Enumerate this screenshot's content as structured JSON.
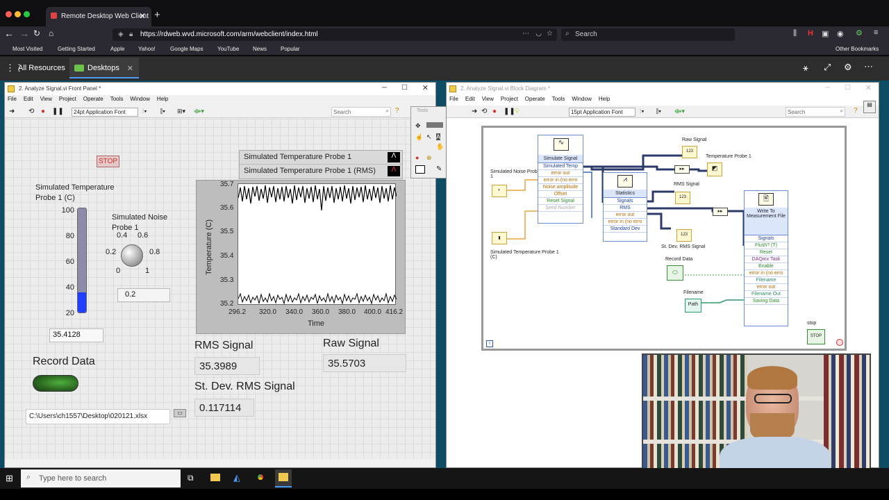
{
  "browser": {
    "tab_title": "Remote Desktop Web Client",
    "url": "https://rdweb.wvd.microsoft.com/arm/webclient/index.html",
    "search_placeholder": "Search",
    "bookmarks": [
      "Most Visited",
      "Getting Started",
      "Apple",
      "Yahoo!",
      "Google Maps",
      "YouTube",
      "News",
      "Popular"
    ],
    "other_bookmarks": "Other Bookmarks"
  },
  "rd": {
    "all_resources": "All Resources",
    "desktops_tab": "Desktops"
  },
  "front_panel": {
    "title": "2. Analyze Signal.vi Front Panel *",
    "menu": [
      "File",
      "Edit",
      "View",
      "Project",
      "Operate",
      "Tools",
      "Window",
      "Help"
    ],
    "font": "24pt Application Font",
    "search": "Search",
    "stop_label": "STOP",
    "thermo_label": "Simulated Temperature Probe 1 (C)",
    "thermo_scale": [
      "100",
      "80",
      "60",
      "40",
      "20"
    ],
    "thermo_value_fraction": 0.19,
    "thermo_display": "35.4128",
    "noise_label": "Simulated Noise Probe 1",
    "knob_ticks": [
      "0.4",
      "0.6",
      "0.2",
      "0.8",
      "0",
      "1"
    ],
    "noise_value": "0.2",
    "legend": [
      "Simulated Temperature Probe 1",
      "Simulated Temperature Probe 1 (RMS)"
    ],
    "graph_ylabel": "Temperature (C)",
    "graph_xlabel": "Time",
    "graph_yticks": [
      "35.7",
      "35.6",
      "35.5",
      "35.4",
      "35.3",
      "35.2"
    ],
    "graph_xticks": [
      "296.2",
      "320.0",
      "340.0",
      "360.0",
      "380.0",
      "400.0",
      "416.2"
    ],
    "rms_label": "RMS Signal",
    "rms_value": "35.3989",
    "raw_label": "Raw Signal",
    "raw_value": "35.5703",
    "stdev_label": "St. Dev. RMS Signal",
    "stdev_value": "0.117114",
    "record_label": "Record Data",
    "file_path": "C:\\Users\\ch1557\\Desktop\\020121.xlsx",
    "tools_title": "Tools"
  },
  "block_diagram": {
    "title": "2. Analyze Signal.vi Block Diagram *",
    "menu": [
      "File",
      "Edit",
      "View",
      "Project",
      "Operate",
      "Tools",
      "Window",
      "Help"
    ],
    "font": "15pt Application Font",
    "search": "Search",
    "sim_signal": {
      "title": "Simulate Signal",
      "rows": [
        "Simulated Temp",
        "error out",
        "error in (no erro",
        "Noise amplitude",
        "Offset",
        "Reset Signal",
        "Seed Number"
      ]
    },
    "statistics": {
      "title": "Statistics",
      "rows": [
        "Signals",
        "RMS",
        "error out",
        "error in (no erro",
        "Standard Dev"
      ]
    },
    "write_file": {
      "title": "Write To Measurement File",
      "rows": [
        "Signals",
        "Flush? (T)",
        "Reset",
        "DAQmx Task",
        "Enable",
        "error in (no erro",
        "Filename",
        "error out",
        "Filename Out",
        "Saving Data"
      ]
    },
    "labels": {
      "noise_probe": "Simulated Noise Probe 1",
      "temp_probe": "Simulated Temperature Probe 1 (C)",
      "raw_signal": "Raw Signal",
      "temperature_probe": "Temperature Probe 1",
      "rms_signal": "RMS Signal",
      "stdev_rms": "St. Dev. RMS Signal",
      "record_data": "Record Data",
      "filename": "Filename",
      "stop": "stop"
    }
  },
  "taskbar": {
    "search_placeholder": "Type here to search"
  }
}
